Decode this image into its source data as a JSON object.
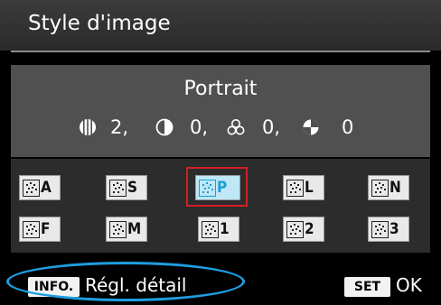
{
  "header": {
    "title": "Style d'image"
  },
  "selected_style": {
    "name": "Portrait"
  },
  "parameters": [
    {
      "icon": "sharpness-icon",
      "value": "2,"
    },
    {
      "icon": "contrast-icon",
      "value": "0,"
    },
    {
      "icon": "saturation-icon",
      "value": "0,"
    },
    {
      "icon": "color-tone-icon",
      "value": "0"
    }
  ],
  "styles": [
    {
      "label": "A",
      "selected": false
    },
    {
      "label": "S",
      "selected": false
    },
    {
      "label": "P",
      "selected": true
    },
    {
      "label": "L",
      "selected": false
    },
    {
      "label": "N",
      "selected": false
    },
    {
      "label": "F",
      "selected": false
    },
    {
      "label": "M",
      "selected": false
    },
    {
      "label": "1",
      "selected": false
    },
    {
      "label": "2",
      "selected": false
    },
    {
      "label": "3",
      "selected": false
    }
  ],
  "footer": {
    "info_key": "INFO.",
    "detail_label": "Régl. détail",
    "set_key": "SET",
    "ok_label": "OK"
  },
  "colors": {
    "highlight": "#1e9ee0",
    "selection_frame": "#d21f28"
  }
}
